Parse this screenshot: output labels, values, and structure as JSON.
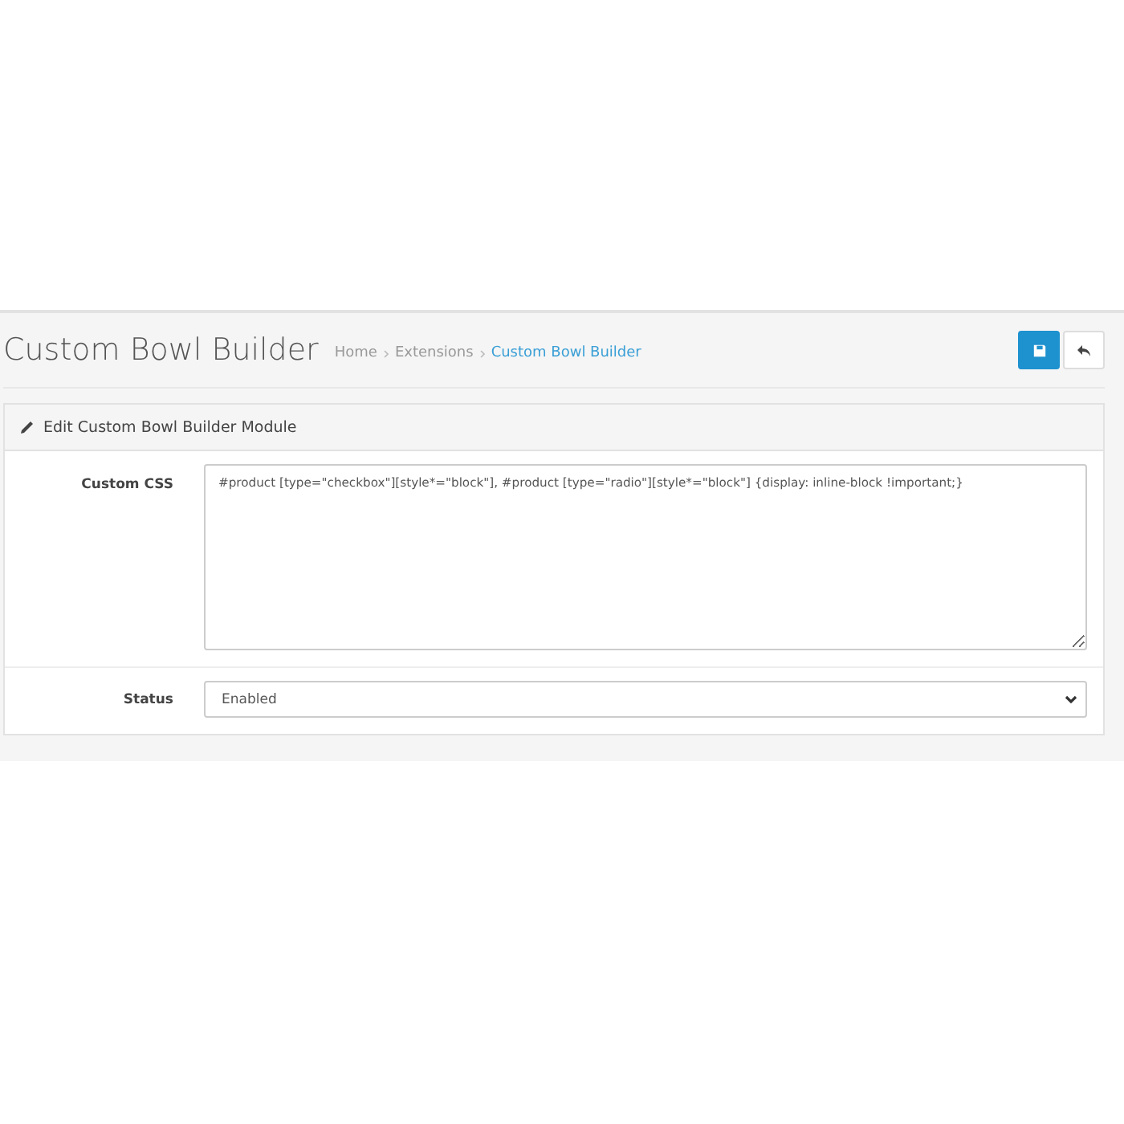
{
  "header": {
    "title": "Custom Bowl Builder",
    "breadcrumbs": [
      {
        "label": "Home",
        "selected": false
      },
      {
        "label": "Extensions",
        "selected": false
      },
      {
        "label": "Custom Bowl Builder",
        "selected": true
      }
    ],
    "buttons": [
      {
        "kind": "save"
      },
      {
        "kind": "back"
      }
    ]
  },
  "panel": {
    "heading": "Edit Custom Bowl Builder Module",
    "fields": [
      {
        "kind": "textarea",
        "label": "Custom CSS",
        "value": "#product [type=\"checkbox\"][style*=\"block\"], #product [type=\"radio\"][style*=\"block\"] {display: inline-block !important;}"
      },
      {
        "kind": "select",
        "label": "Status",
        "value": "Enabled"
      }
    ]
  }
}
